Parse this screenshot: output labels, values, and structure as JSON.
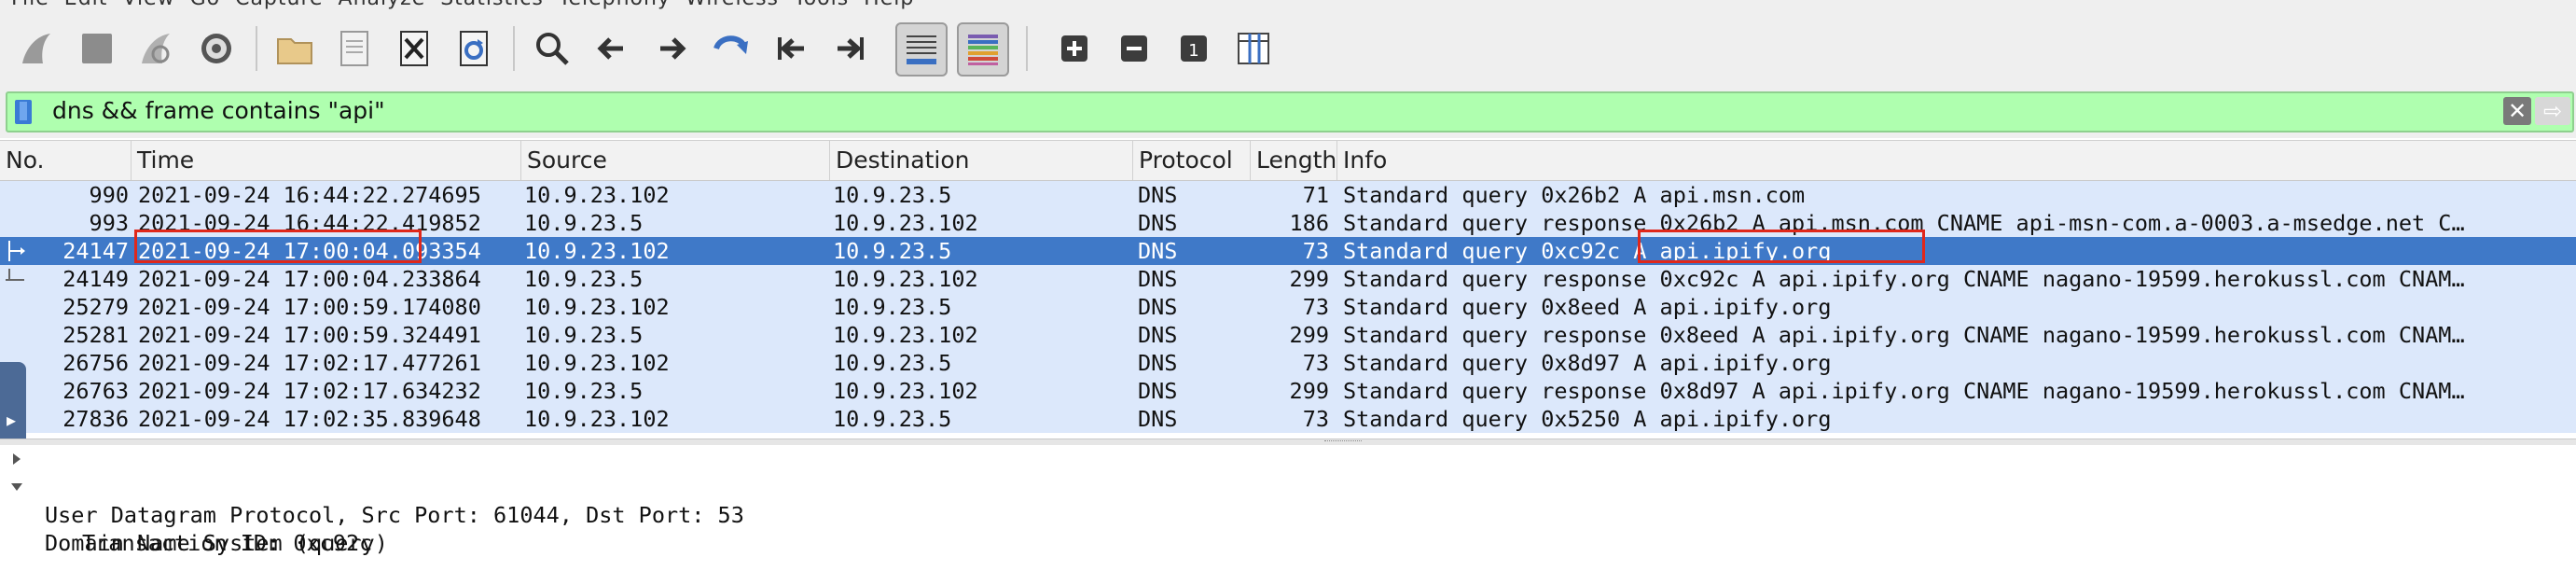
{
  "menu": {
    "text": "File  Edit  View  Go  Capture  Analyze  Statistics  Telephony  Wireless  Tools  Help"
  },
  "toolbar": {
    "buttons": [
      {
        "icon": "shark-fin-start-icon"
      },
      {
        "icon": "stop-capture-icon"
      },
      {
        "icon": "restart-capture-icon"
      },
      {
        "icon": "capture-options-gear-icon"
      },
      {
        "icon": "open-folder-icon"
      },
      {
        "icon": "save-file-icon"
      },
      {
        "icon": "close-file-icon"
      },
      {
        "icon": "reload-file-icon"
      },
      {
        "icon": "find-packet-icon"
      },
      {
        "icon": "go-back-icon"
      },
      {
        "icon": "go-forward-icon"
      },
      {
        "icon": "go-to-packet-icon"
      },
      {
        "icon": "go-first-icon"
      },
      {
        "icon": "go-last-icon"
      },
      {
        "icon": "auto-scroll-icon"
      },
      {
        "icon": "colorize-icon"
      },
      {
        "icon": "zoom-in-icon"
      },
      {
        "icon": "zoom-out-icon"
      },
      {
        "icon": "normal-size-icon"
      },
      {
        "icon": "resize-columns-icon"
      }
    ]
  },
  "filter": {
    "value": "dns && frame contains \"api\"",
    "accent": "#afffaf"
  },
  "packet_list": {
    "columns": [
      "No.",
      "Time",
      "Source",
      "Destination",
      "Protocol",
      "Length",
      "Info"
    ],
    "rows": [
      {
        "no": "990",
        "time": "2021-09-24 16:44:22.274695",
        "src": "10.9.23.102",
        "dst": "10.9.23.5",
        "proto": "DNS",
        "len": "71",
        "info": "Standard query 0x26b2 A api.msn.com",
        "selected": false
      },
      {
        "no": "993",
        "time": "2021-09-24 16:44:22.419852",
        "src": "10.9.23.5",
        "dst": "10.9.23.102",
        "proto": "DNS",
        "len": "186",
        "info": "Standard query response 0x26b2 A api.msn.com CNAME api-msn-com.a-0003.a-msedge.net C…",
        "selected": false
      },
      {
        "no": "24147",
        "time": "2021-09-24 17:00:04.093354",
        "src": "10.9.23.102",
        "dst": "10.9.23.5",
        "proto": "DNS",
        "len": "73",
        "info": "Standard query 0xc92c A api.ipify.org",
        "selected": true
      },
      {
        "no": "24149",
        "time": "2021-09-24 17:00:04.233864",
        "src": "10.9.23.5",
        "dst": "10.9.23.102",
        "proto": "DNS",
        "len": "299",
        "info": "Standard query response 0xc92c A api.ipify.org CNAME nagano-19599.herokussl.com CNAM…",
        "selected": false
      },
      {
        "no": "25279",
        "time": "2021-09-24 17:00:59.174080",
        "src": "10.9.23.102",
        "dst": "10.9.23.5",
        "proto": "DNS",
        "len": "73",
        "info": "Standard query 0x8eed A api.ipify.org",
        "selected": false
      },
      {
        "no": "25281",
        "time": "2021-09-24 17:00:59.324491",
        "src": "10.9.23.5",
        "dst": "10.9.23.102",
        "proto": "DNS",
        "len": "299",
        "info": "Standard query response 0x8eed A api.ipify.org CNAME nagano-19599.herokussl.com CNAM…",
        "selected": false
      },
      {
        "no": "26756",
        "time": "2021-09-24 17:02:17.477261",
        "src": "10.9.23.102",
        "dst": "10.9.23.5",
        "proto": "DNS",
        "len": "73",
        "info": "Standard query 0x8d97 A api.ipify.org",
        "selected": false
      },
      {
        "no": "26763",
        "time": "2021-09-24 17:02:17.634232",
        "src": "10.9.23.5",
        "dst": "10.9.23.102",
        "proto": "DNS",
        "len": "299",
        "info": "Standard query response 0x8d97 A api.ipify.org CNAME nagano-19599.herokussl.com CNAM…",
        "selected": false
      },
      {
        "no": "27836",
        "time": "2021-09-24 17:02:35.839648",
        "src": "10.9.23.102",
        "dst": "10.9.23.5",
        "proto": "DNS",
        "len": "73",
        "info": "Standard query 0x5250 A api.ipify.org",
        "selected": false
      }
    ],
    "row_color": "#dce8fb",
    "selected_color": "#3f79c8",
    "highlight_color": "#e0271b"
  },
  "details": {
    "lines": [
      {
        "text": "User Datagram Protocol, Src Port: 61044, Dst Port: 53",
        "expanded": false
      },
      {
        "text": "Domain Name System (query)",
        "expanded": true
      },
      {
        "text": "Transaction ID: 0xc92c",
        "expanded": null
      }
    ]
  }
}
